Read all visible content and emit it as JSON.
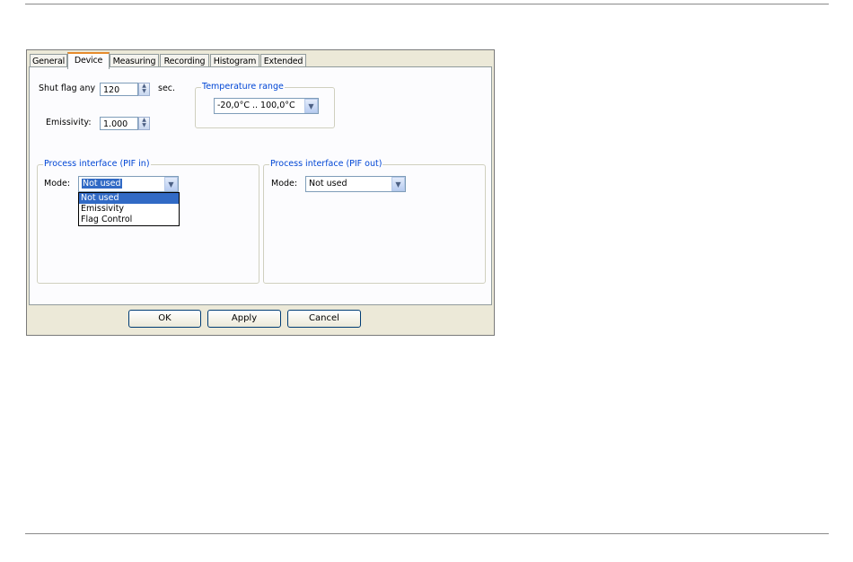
{
  "tabs": [
    {
      "label": "General"
    },
    {
      "label": "Device"
    },
    {
      "label": "Measuring"
    },
    {
      "label": "Recording"
    },
    {
      "label": "Histogram"
    },
    {
      "label": "Extended"
    }
  ],
  "active_tab": "Device",
  "device": {
    "shut_flag_label": "Shut flag any",
    "shut_flag_value": "120",
    "shut_flag_unit": "sec.",
    "emissivity_label": "Emissivity:",
    "emissivity_value": "1.000",
    "temp_range_legend": "Temperature range",
    "temp_range_value": "-20,0°C .. 100,0°C"
  },
  "pif_in": {
    "legend": "Process interface (PIF in)",
    "mode_label": "Mode:",
    "mode_value": "Not used",
    "options": [
      "Not used",
      "Emissivity",
      "Flag Control"
    ],
    "selected_option": "Not used"
  },
  "pif_out": {
    "legend": "Process interface (PIF out)",
    "mode_label": "Mode:",
    "mode_value": "Not used"
  },
  "buttons": {
    "ok": "OK",
    "apply": "Apply",
    "cancel": "Cancel"
  },
  "icons": {
    "spin": "spin-up-down-icon",
    "dropdown": "chevron-down-icon"
  },
  "colors": {
    "selection": "#316ac5",
    "legend_text": "#0046d5",
    "dialog_bg": "#ece9d8"
  }
}
